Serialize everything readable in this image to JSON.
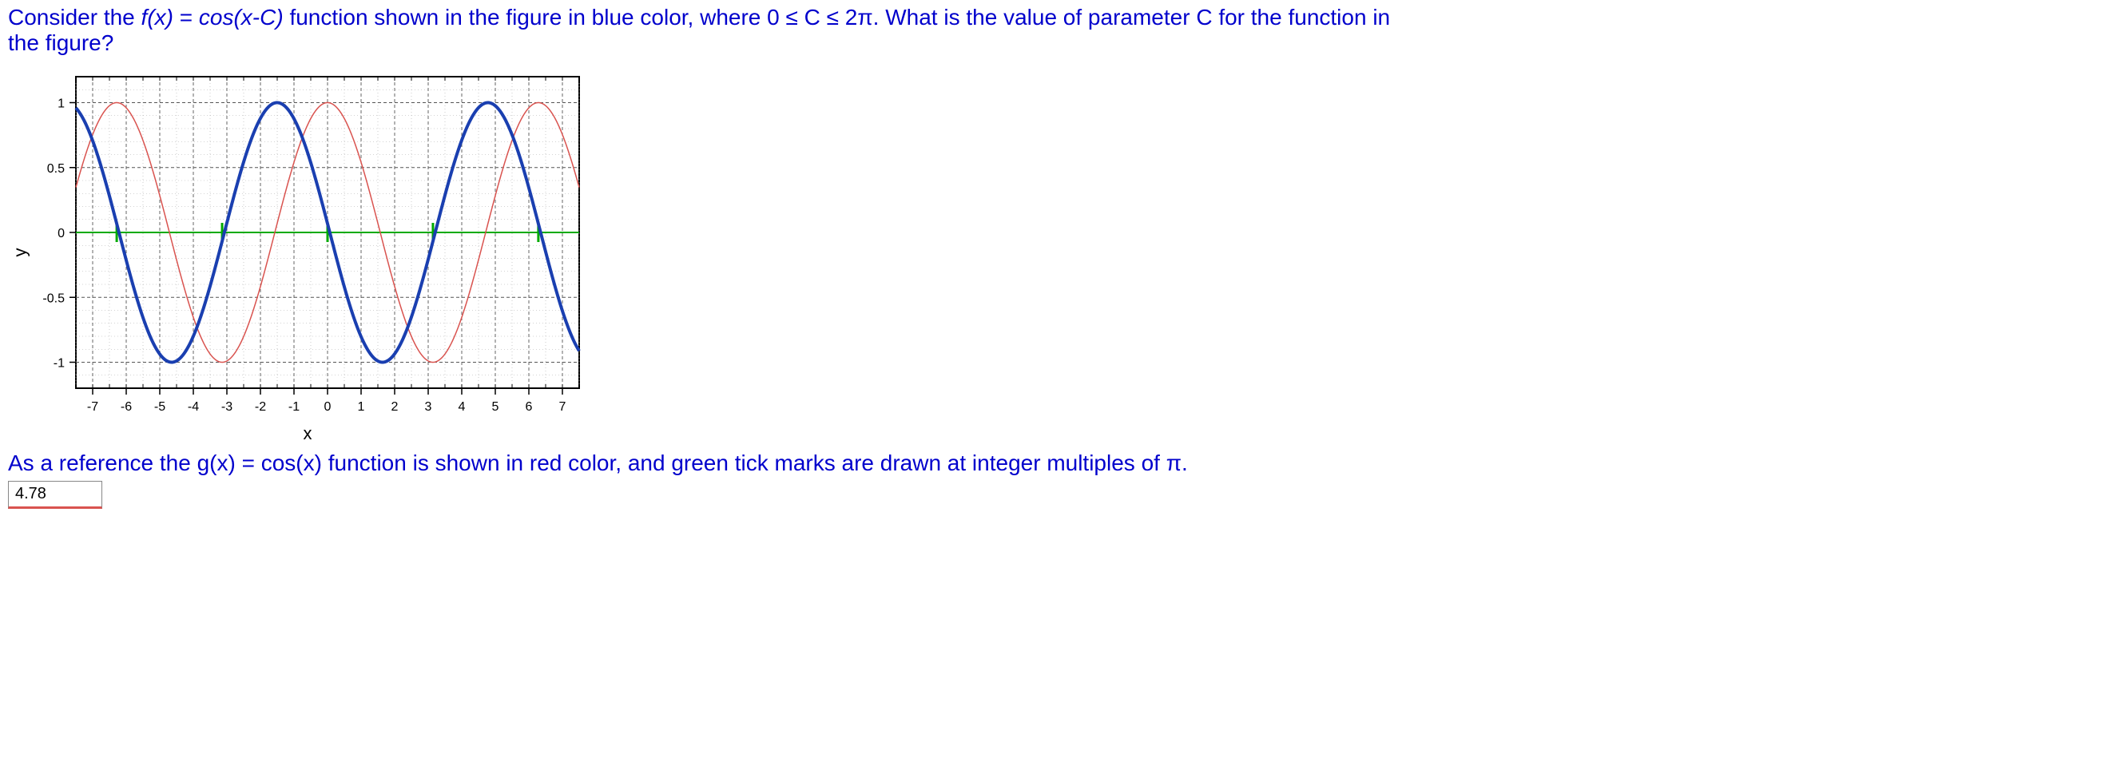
{
  "prompt": {
    "line1_pre": "Consider the ",
    "fx": "f(x)",
    "eq": " = ",
    "cos": "cos(x-C)",
    "line1_post": " function shown in the figure in blue color, where 0 ≤ C ≤ 2π. What is the value of parameter C for the function in",
    "line2": "the figure?"
  },
  "note": {
    "pre": "As a reference the ",
    "gx": "g(x)",
    "eq": " = ",
    "cos": "cos(x)",
    "post": " function is shown in red color, and green tick marks are drawn at integer multiples of π."
  },
  "answer": "4.78",
  "chart_data": {
    "type": "line",
    "title": "",
    "xlabel": "x",
    "ylabel": "y",
    "xlim": [
      -7.5,
      7.5
    ],
    "ylim": [
      -1.2,
      1.2
    ],
    "xticks": [
      -7,
      -6,
      -5,
      -4,
      -3,
      -2,
      -1,
      0,
      1,
      2,
      3,
      4,
      5,
      6,
      7
    ],
    "yticks": [
      -1,
      -0.5,
      0,
      0.5,
      1
    ],
    "minor_xticks_every": 0.5,
    "minor_yticks": true,
    "grid": {
      "major": "dashed",
      "minor": "dotted"
    },
    "green_ticks_at_pi_multiples": [
      -6.2832,
      -3.1416,
      0,
      3.1416,
      6.2832
    ],
    "series": [
      {
        "name": "g(x)=cos(x)",
        "color": "#d9534f",
        "style": "thin",
        "formula": "cos(x)"
      },
      {
        "name": "f(x)=cos(x-C), C≈4.78",
        "color": "#1a3fb0",
        "style": "thick",
        "formula": "cos(x-4.78)",
        "peaks_x": [
          -7.79,
          -1.5,
          4.78
        ],
        "troughs_x": [
          -4.64,
          1.64,
          7.92
        ]
      }
    ]
  }
}
